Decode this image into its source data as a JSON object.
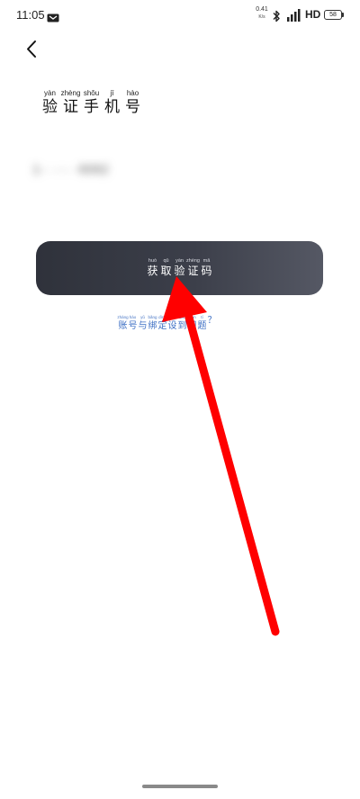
{
  "status_bar": {
    "time": "11:05",
    "net_speed": "0.41",
    "net_unit": "K/s",
    "network_type": "HD",
    "battery": "58"
  },
  "title": {
    "chars": [
      {
        "py": "yàn",
        "hz": "验"
      },
      {
        "py": "zhèng",
        "hz": "证"
      },
      {
        "py": "shǒu",
        "hz": "手"
      },
      {
        "py": "jī",
        "hz": "机"
      },
      {
        "py": "hào",
        "hz": "号"
      }
    ]
  },
  "phone": {
    "masked_number": "1·· ···· ·6062"
  },
  "get_code_button": {
    "chars": [
      {
        "py": "huò",
        "hz": "获"
      },
      {
        "py": "qǔ",
        "hz": "取"
      },
      {
        "py": "yàn",
        "hz": "验"
      },
      {
        "py": "zhèng",
        "hz": "证"
      },
      {
        "py": "mǎ",
        "hz": "码"
      }
    ]
  },
  "help_link": {
    "chars": [
      {
        "py": "zhàng",
        "hz": "账"
      },
      {
        "py": "hào",
        "hz": "号"
      },
      {
        "py": "yǔ",
        "hz": "与"
      },
      {
        "py": "bǎng",
        "hz": "绑"
      },
      {
        "py": "dìng",
        "hz": "定"
      },
      {
        "py": "shè",
        "hz": "设"
      },
      {
        "py": "dào",
        "hz": "到"
      },
      {
        "py": "wèn",
        "hz": "问"
      },
      {
        "py": "tí",
        "hz": "题"
      },
      {
        "py": "",
        "hz": "？"
      }
    ]
  },
  "icons": {
    "back": "chevron-left-icon",
    "app": "notification-app-icon",
    "bluetooth": "bluetooth-icon",
    "signal": "signal-icon",
    "arrow": "red-arrow-annotation-icon"
  },
  "colors": {
    "button_start": "#2f323b",
    "button_end": "#555864",
    "link": "#3d6fc4",
    "arrow": "#ff0000"
  }
}
